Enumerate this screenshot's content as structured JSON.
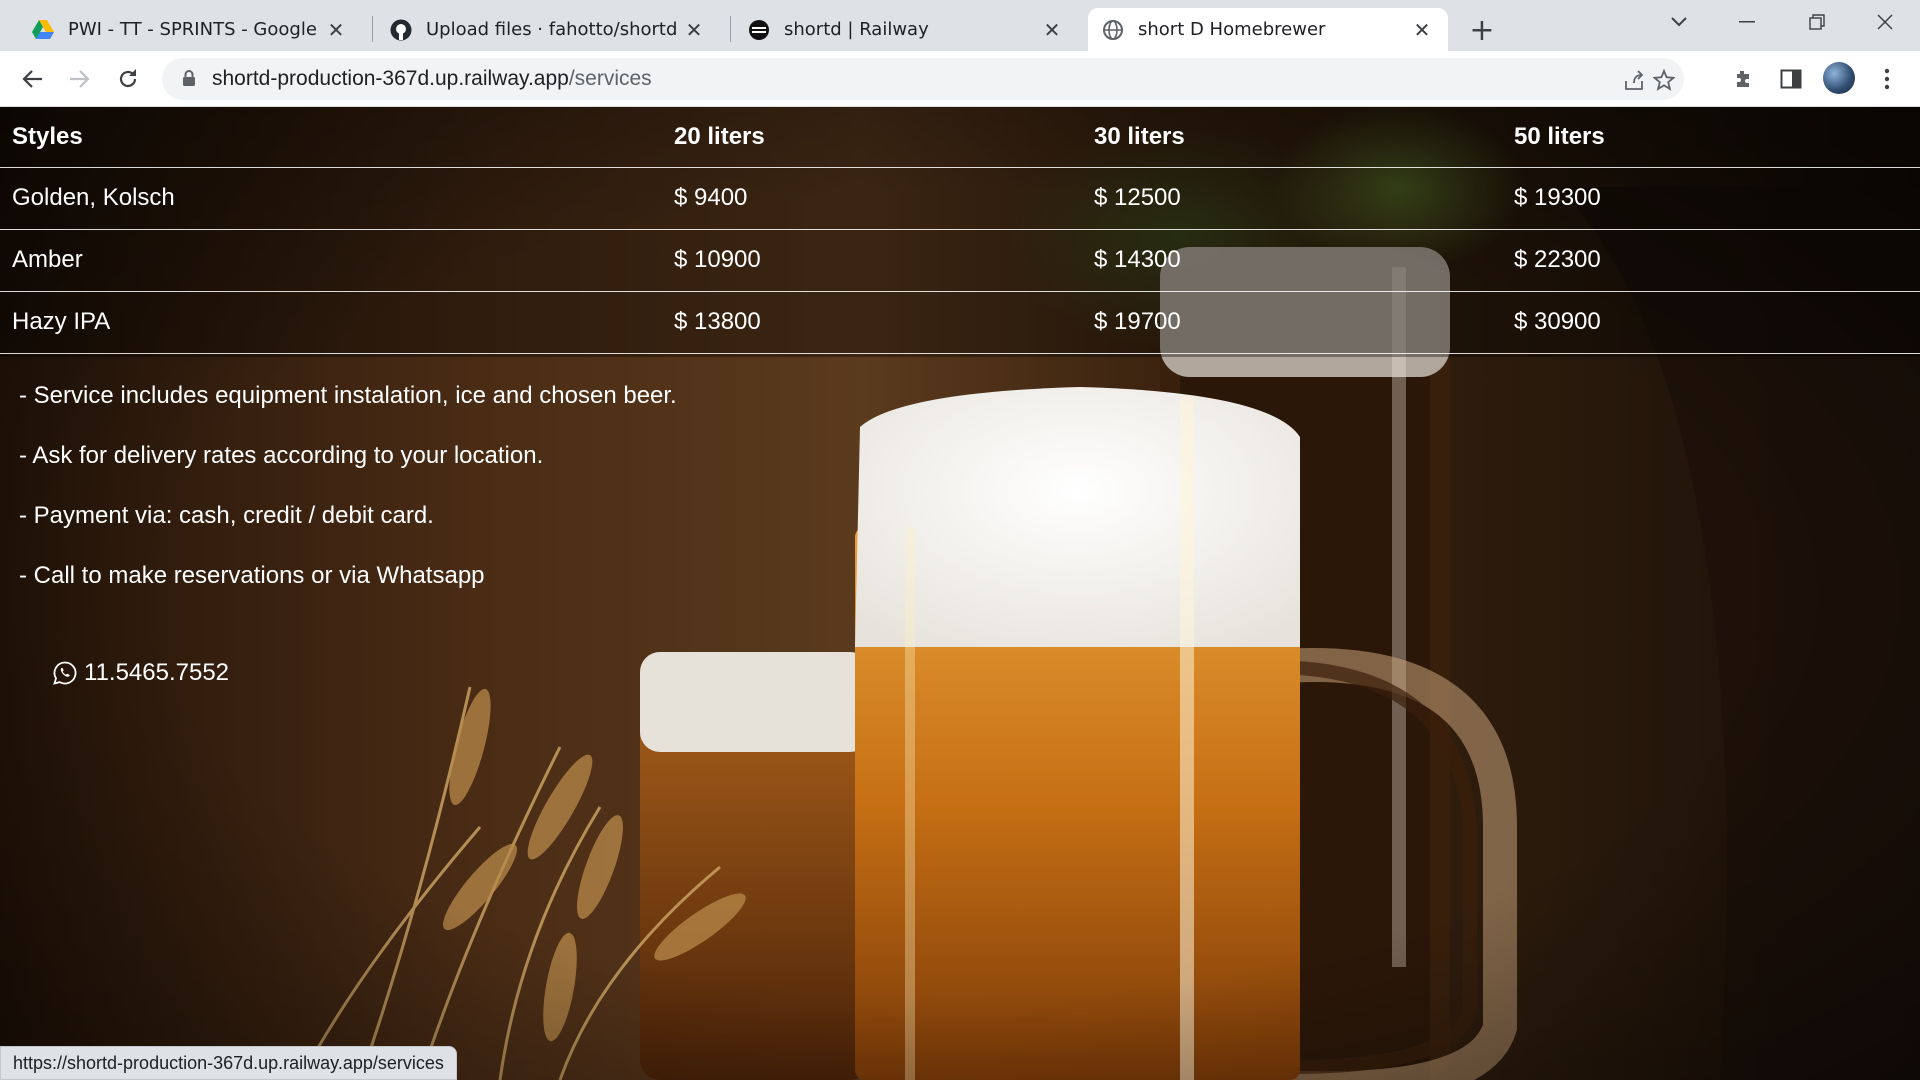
{
  "browser": {
    "tabs": [
      {
        "title": "PWI - TT - SPRINTS - Google Driv",
        "favicon": "google-drive-icon"
      },
      {
        "title": "Upload files · fahotto/shortd",
        "favicon": "github-icon"
      },
      {
        "title": "shortd | Railway",
        "favicon": "railway-icon"
      },
      {
        "title": "short D Homebrewer",
        "favicon": "globe-icon",
        "active": true
      }
    ],
    "url_host": "shortd-production-367d.up.railway.app",
    "url_path": "/services",
    "status_url": "https://shortd-production-367d.up.railway.app/services"
  },
  "page": {
    "table": {
      "headers": [
        "Styles",
        "20 liters",
        "30 liters",
        "50 liters"
      ],
      "rows": [
        [
          "Golden, Kolsch",
          "$ 9400",
          "$ 12500",
          "$ 19300"
        ],
        [
          "Amber",
          "$ 10900",
          "$ 14300",
          "$ 22300"
        ],
        [
          "Hazy IPA",
          "$ 13800",
          "$ 19700",
          "$ 30900"
        ]
      ]
    },
    "notes": [
      "- Service includes equipment instalation, ice and chosen beer.",
      "- Ask for delivery rates according to your location.",
      "- Payment via: cash, credit / debit card.",
      "- Call to make reservations or via Whatsapp"
    ],
    "phone": "11.5465.7552"
  },
  "colors": {
    "tabstrip": "#dee1e6",
    "toolbar": "#ffffff",
    "text_on_page": "#ffffff"
  }
}
